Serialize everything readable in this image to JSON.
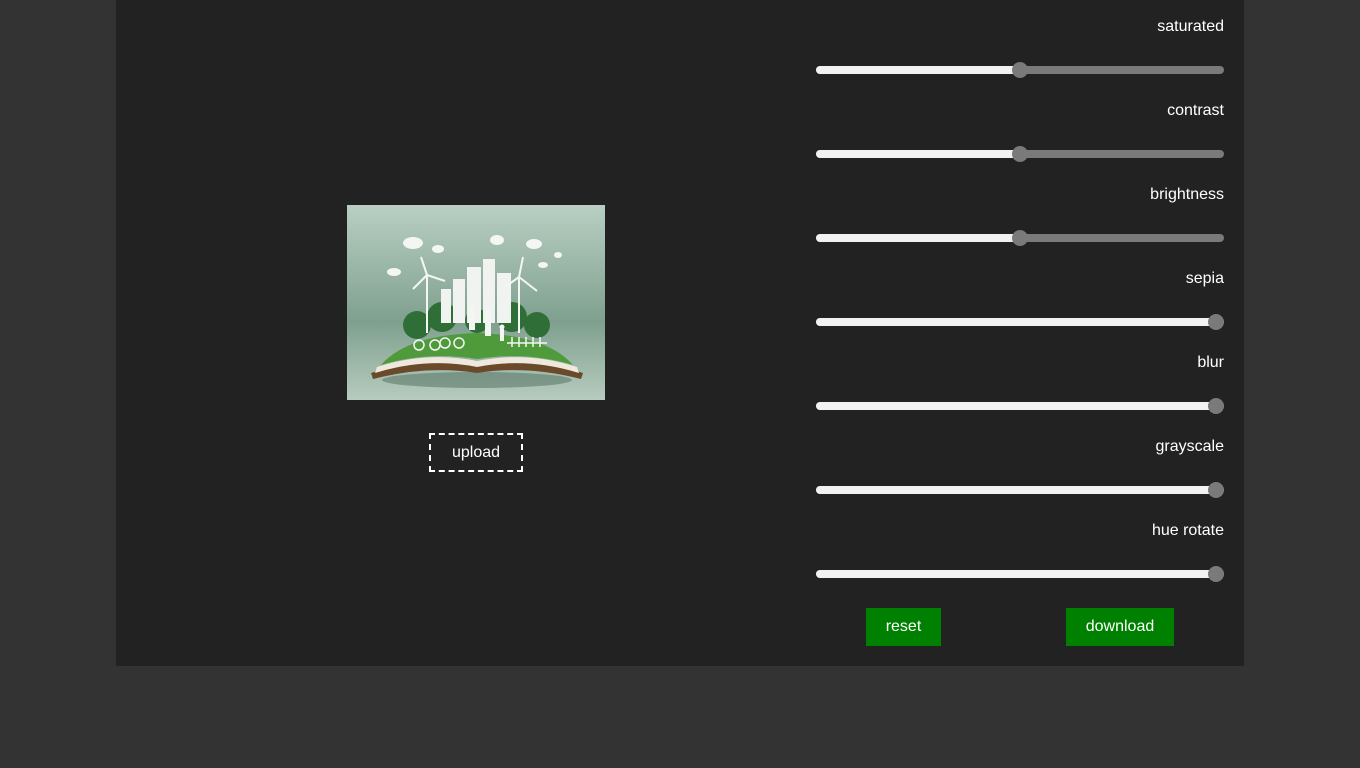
{
  "upload": {
    "label": "upload"
  },
  "filters": [
    {
      "id": "saturated",
      "label": "saturated",
      "value": 0.5
    },
    {
      "id": "contrast",
      "label": "contrast",
      "value": 0.5
    },
    {
      "id": "brightness",
      "label": "brightness",
      "value": 0.5
    },
    {
      "id": "sepia",
      "label": "sepia",
      "value": 1.0
    },
    {
      "id": "blur",
      "label": "blur",
      "value": 1.0
    },
    {
      "id": "grayscale",
      "label": "grayscale",
      "value": 1.0
    },
    {
      "id": "hue_rotate",
      "label": "hue rotate",
      "value": 1.0
    }
  ],
  "actions": {
    "reset_label": "reset",
    "download_label": "download"
  },
  "colors": {
    "page_bg": "#333333",
    "panel_bg": "#222222",
    "button_green": "#008000",
    "track_light": "#f2f2f2",
    "track_dark": "#7a7a7a"
  }
}
